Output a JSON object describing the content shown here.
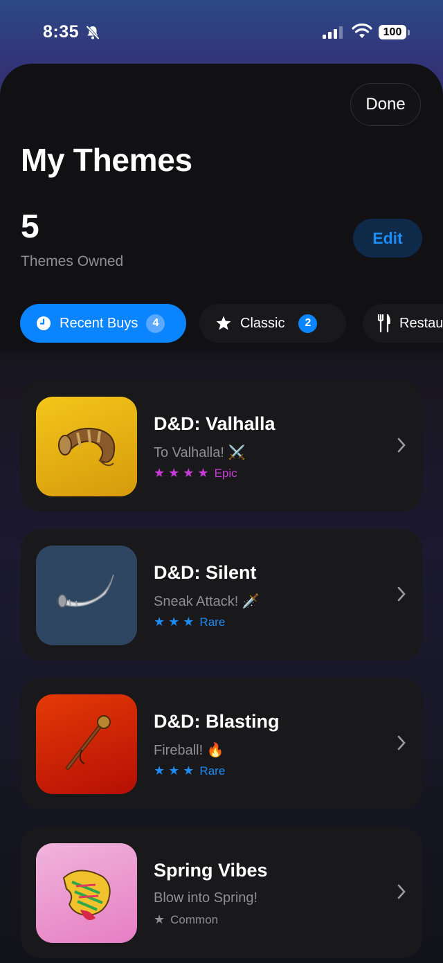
{
  "status": {
    "time": "8:35",
    "battery": "100"
  },
  "header": {
    "done_label": "Done",
    "title": "My Themes",
    "owned_count": "5",
    "owned_label": "Themes Owned",
    "edit_label": "Edit"
  },
  "filters": [
    {
      "label": "Recent Buys",
      "count": "4",
      "icon": "clock-icon",
      "selected": true
    },
    {
      "label": "Classic",
      "count": "2",
      "icon": "star-icon",
      "selected": false
    },
    {
      "label": "Restau",
      "icon": "fork-knife-icon",
      "selected": false
    }
  ],
  "themes": [
    {
      "title": "D&D: Valhalla",
      "subtitle": "To Valhalla! ⚔️",
      "stars": "★ ★ ★ ★",
      "rarity": "Epic",
      "rarity_color": "#c93bd9",
      "icon": "drinking-horn-icon",
      "bg": "#eab416"
    },
    {
      "title": "D&D: Silent",
      "subtitle": "Sneak Attack! 🗡️",
      "stars": "★ ★ ★",
      "rarity": "Rare",
      "rarity_color": "#1d8cf5",
      "icon": "white-horn-icon",
      "bg": "#2e4661"
    },
    {
      "title": "D&D: Blasting",
      "subtitle": "Fireball! 🔥",
      "stars": "★ ★ ★",
      "rarity": "Rare",
      "rarity_color": "#1d8cf5",
      "icon": "staff-icon",
      "bg": "#d52a08"
    },
    {
      "title": "Spring Vibes",
      "subtitle": "Blow into Spring!",
      "stars": "★",
      "rarity": "Common",
      "rarity_color": "#8e8e93",
      "icon": "conch-shell-icon",
      "bg": "#eca6d3"
    }
  ]
}
